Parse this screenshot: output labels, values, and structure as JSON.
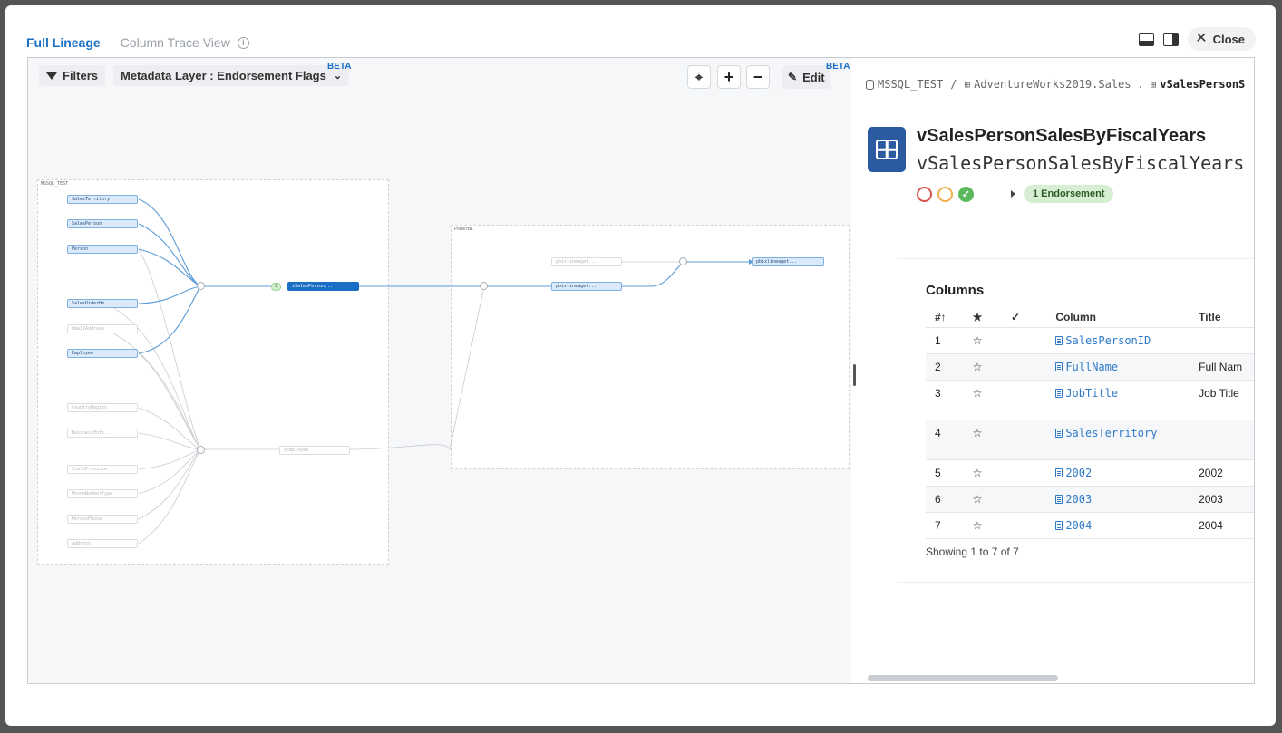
{
  "tabs": {
    "full_lineage": "Full Lineage",
    "column_trace": "Column Trace View"
  },
  "header": {
    "close": "Close"
  },
  "toolbar": {
    "filters": "Filters",
    "metadata_layer": "Metadata Layer : Endorsement Flags",
    "beta": "BETA",
    "edit": "Edit"
  },
  "graph": {
    "group_mssql": "MSSQL_TEST",
    "group_powerbi": "PowerBI",
    "sources_blue": [
      "SalesTerritory",
      "SalesPerson",
      "Person",
      "SalesOrderHe...",
      "Employee"
    ],
    "sources_gray": [
      "EmailAddress",
      "CountryRegion",
      "BusinessEnti...",
      "StateProvince",
      "PhoneNumberType",
      "PersonPhone",
      "Address"
    ],
    "endorse_pill": "1",
    "selected": "vSalesPerson...",
    "vemployee": "vEmployee",
    "pbi_gray": "pbixlineaget...",
    "pbi_blue": "pbixlineaget...",
    "pbi_out": "pbixlineaget..."
  },
  "panel": {
    "breadcrumb": {
      "db": "MSSQL_TEST",
      "sep": "/",
      "schema": "AdventureWorks2019.Sales",
      "dot": ".",
      "entity": "vSalesPersonS"
    },
    "title": "vSalesPersonSalesByFiscalYears",
    "subtitle": "vSalesPersonSalesByFiscalYears",
    "endorsement": "1 Endorsement",
    "columns_heading": "Columns",
    "headers": {
      "num": "#↑",
      "star": "★",
      "check": "✓",
      "column": "Column",
      "title": "Title"
    },
    "rows": [
      {
        "num": "1",
        "name": "SalesPersonID",
        "title": ""
      },
      {
        "num": "2",
        "name": "FullName",
        "title": "Full Nam"
      },
      {
        "num": "3",
        "name": "JobTitle",
        "title": "Job Title"
      },
      {
        "num": "4",
        "name": "SalesTerritory",
        "title": ""
      },
      {
        "num": "5",
        "name": "2002",
        "title": "2002"
      },
      {
        "num": "6",
        "name": "2003",
        "title": "2003"
      },
      {
        "num": "7",
        "name": "2004",
        "title": "2004"
      }
    ],
    "showing": "Showing 1 to 7 of 7"
  }
}
